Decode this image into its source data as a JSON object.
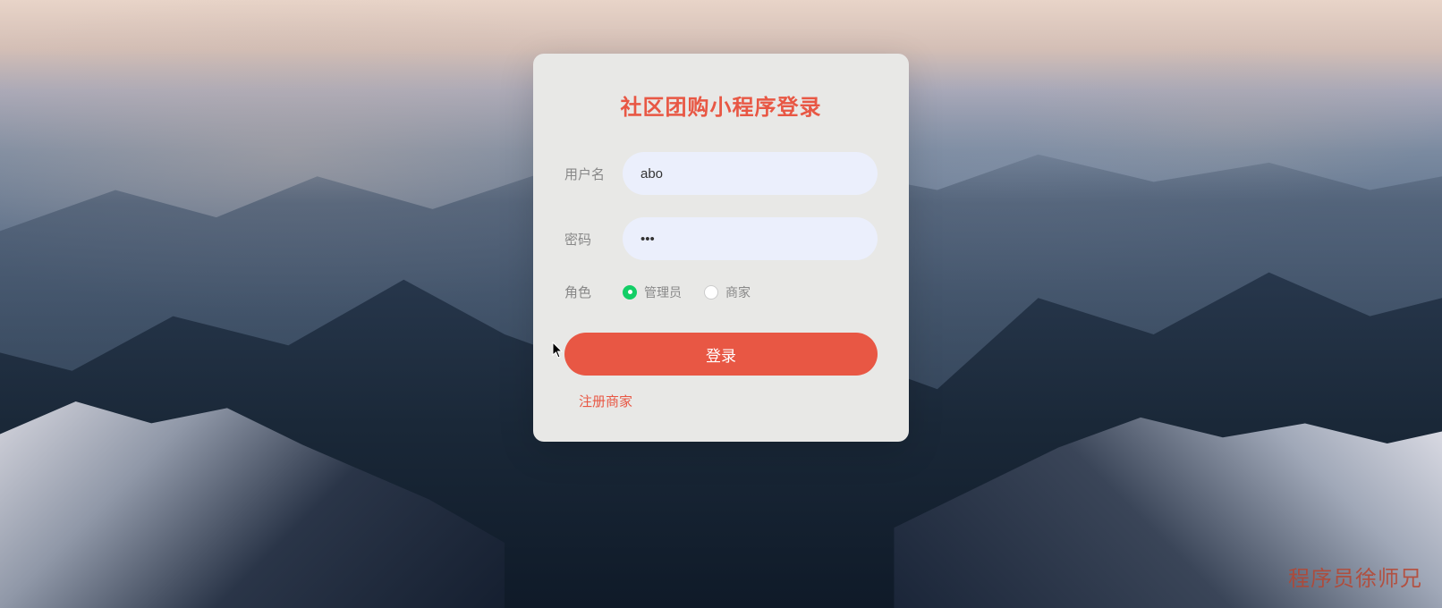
{
  "title": "社区团购小程序登录",
  "form": {
    "username": {
      "label": "用户名",
      "value": "abo"
    },
    "password": {
      "label": "密码",
      "value": "•••"
    },
    "role": {
      "label": "角色",
      "options": [
        {
          "label": "管理员",
          "selected": true
        },
        {
          "label": "商家",
          "selected": false
        }
      ]
    }
  },
  "buttons": {
    "login": "登录"
  },
  "links": {
    "register": "注册商家"
  },
  "watermark": "程序员徐师兄",
  "colors": {
    "accent": "#e85744",
    "radio_selected": "#13ce66",
    "input_bg": "#ebeffc",
    "card_bg": "#e8e8e6"
  }
}
